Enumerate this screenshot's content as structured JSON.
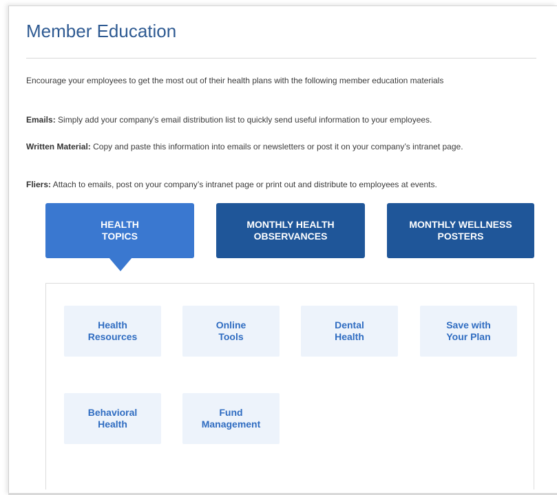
{
  "page": {
    "title": "Member Education",
    "intro": "Encourage your employees to get the most out of their health plans with the following member education materials"
  },
  "paragraphs": {
    "emails": {
      "label": "Emails:",
      "text": " Simply add your company’s email distribution list to quickly send useful information to your employees."
    },
    "written": {
      "label": "Written Material:",
      "text": " Copy and paste this information into emails or newsletters or post it on your company’s intranet page."
    },
    "fliers": {
      "label": "Fliers:",
      "text": " Attach to emails, post on your company’s intranet page or print out and distribute to employees at events."
    }
  },
  "tabs": [
    {
      "line1": "HEALTH",
      "line2": "TOPICS",
      "active": true
    },
    {
      "line1": "MONTHLY HEALTH",
      "line2": "OBSERVANCES",
      "active": false
    },
    {
      "line1": "MONTHLY WELLNESS",
      "line2": "POSTERS",
      "active": false
    }
  ],
  "topics": [
    {
      "line1": "Health",
      "line2": "Resources"
    },
    {
      "line1": "Online",
      "line2": "Tools"
    },
    {
      "line1": "Dental",
      "line2": "Health"
    },
    {
      "line1": "Save with",
      "line2": "Your Plan"
    },
    {
      "line1": "Behavioral",
      "line2": "Health"
    },
    {
      "line1": "Fund",
      "line2": "Management"
    }
  ],
  "colors": {
    "title": "#2e5a92",
    "tab_active": "#3a78d0",
    "tab_inactive": "#1f5699",
    "tile_bg": "#edf3fb",
    "tile_text": "#2f6cc1"
  }
}
